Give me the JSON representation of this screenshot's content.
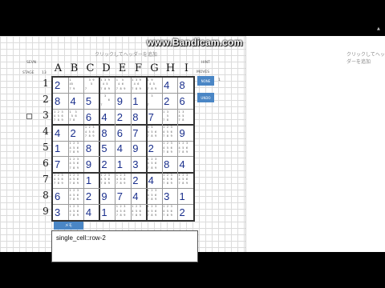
{
  "watermark": "www.Bandicam.com",
  "header_hint": "クリックしてヘッダーを追加",
  "right_header_hint": "クリックしてヘッダーを追加",
  "labels": {
    "seven": "SEVN",
    "stage": "STAGE",
    "stage_val": "13",
    "hint": "HINT",
    "moves": "MOVES",
    "moves_val": "1"
  },
  "buttons": {
    "side_1": "NONE",
    "side_2": "UNDO",
    "memo_tab": "メモ"
  },
  "columns": [
    "A",
    "B",
    "C",
    "D",
    "E",
    "F",
    "G",
    "H",
    "I"
  ],
  "rows": [
    "1",
    "2",
    "3",
    "4",
    "5",
    "6",
    "7",
    "8",
    "9"
  ],
  "board": [
    [
      {
        "v": "2"
      },
      {
        "n": "1    \n45   \n7 9  "
      },
      {
        "n": "  3 9\n   5\n7    "
      },
      {
        "n": "1 3 9\n 4 5 \n7 8 9"
      },
      {
        "n": "1  5 \n 4 6 \n7 8 9"
      },
      {
        "n": "1 3 9\n 4 6 \n7 8 9"
      },
      {
        "n": "1 9  \n 4 5 \n7 8 9"
      },
      {
        "v": "4"
      },
      {
        "v": "8"
      }
    ],
    [
      {
        "v": "8"
      },
      {
        "v": "4"
      },
      {
        "v": "5"
      },
      {
        "n": "  3  \n    6\n7    "
      },
      {
        "v": "9"
      },
      {
        "v": "1"
      },
      {
        "n": "  3 \n    \n7    "
      },
      {
        "v": "2"
      },
      {
        "v": "6"
      }
    ],
    [
      {
        "n": "1 2 3\n4 5 6\n7 8 9"
      },
      {
        "n": "1  3 \n 5 6 \n7 8  "
      },
      {
        "v": "6"
      },
      {
        "v": "4"
      },
      {
        "v": "2"
      },
      {
        "v": "8"
      },
      {
        "v": "7"
      },
      {
        "n": "1 3 \n  5 \n7 8 "
      },
      {
        "n": "1 3 \n4 5 \n7 8 "
      }
    ],
    [
      {
        "v": "4"
      },
      {
        "v": "2"
      },
      {
        "n": "1 2 3\n4 5 6\n7 8 9"
      },
      {
        "v": "8"
      },
      {
        "v": "6"
      },
      {
        "v": "7"
      },
      {
        "n": "3 5 \n4 5 6\n7 8 9"
      },
      {
        "n": "1 2 3\n4 5 6\n7 8 9"
      },
      {
        "v": "9"
      }
    ],
    [
      {
        "v": "1"
      },
      {
        "n": "1 2 3\n4 5 6\n7 8 9"
      },
      {
        "v": "8"
      },
      {
        "v": "5"
      },
      {
        "v": "4"
      },
      {
        "v": "9"
      },
      {
        "v": "2"
      },
      {
        "n": "1 2 3\n4 5 6\n7 8 9"
      },
      {
        "n": "1 2 3\n4 5 6\n7 8 9"
      }
    ],
    [
      {
        "v": "7"
      },
      {
        "n": "1 2 3\n4 5 6\n7 8 9"
      },
      {
        "v": "9"
      },
      {
        "v": "2"
      },
      {
        "v": "1"
      },
      {
        "v": "3"
      },
      {
        "n": "1 2 3\n4 5 6\n7 8 9"
      },
      {
        "v": "8"
      },
      {
        "v": "4"
      }
    ],
    [
      {
        "n": "1 2 3\n4 5 6\n7 8 9"
      },
      {
        "n": "1 2 3\n4 5 6\n7 8 9"
      },
      {
        "v": "1"
      },
      {
        "n": "1 2 3\n4 5 6\n7 8 9"
      },
      {
        "n": "1 2 3\n4 5 6\n7 8 9"
      },
      {
        "v": "2"
      },
      {
        "v": "4"
      },
      {
        "n": "1 2 3\n4 5 6\n7 8 9"
      },
      {
        "n": "1 2 3\n4 5 6\n7 8 9"
      }
    ],
    [
      {
        "v": "6"
      },
      {
        "n": "1 2 3\n4 5 6\n7 8 9"
      },
      {
        "v": "2"
      },
      {
        "v": "9"
      },
      {
        "v": "7"
      },
      {
        "v": "4"
      },
      {
        "n": "1 2 3\n4 5 6\n7 8 9"
      },
      {
        "v": "3"
      },
      {
        "v": "1"
      }
    ],
    [
      {
        "v": "3"
      },
      {
        "n": "1 2 3\n4 5 6\n7 8 9"
      },
      {
        "v": "4"
      },
      {
        "v": "1"
      },
      {
        "n": "1 2 3\n4 5 6\n7 8 9"
      },
      {
        "n": "1 2 3\n4 5 6\n7 8 9"
      },
      {
        "n": "1 2 3\n4 5 6\n7 8 9"
      },
      {
        "n": "1 2 3\n4 5 6\n7 8 9"
      },
      {
        "v": "2"
      }
    ]
  ],
  "memo_text": "single_cell::row-2",
  "colors": {
    "accent": "#4a86c5",
    "digit": "#1a2f8c"
  }
}
